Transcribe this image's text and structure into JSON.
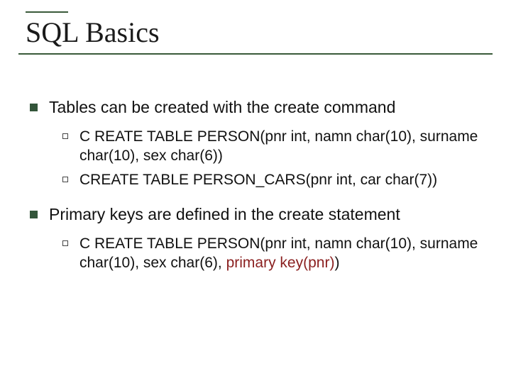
{
  "slide": {
    "title": "SQL Basics",
    "items": [
      {
        "text": "Tables can be created with the create command",
        "sub": [
          {
            "text": "C REATE TABLE PERSON(pnr int, namn char(10), surname char(10), sex char(6))"
          },
          {
            "text": "CREATE TABLE PERSON_CARS(pnr int, car char(7))"
          }
        ]
      },
      {
        "text": "Primary keys are defined in the create statement",
        "sub": [
          {
            "text_prefix": "C REATE TABLE PERSON(pnr int, namn char(10), surname char(10), sex char(6), ",
            "highlight": "primary key(pnr)",
            "text_suffix": ")"
          }
        ]
      }
    ]
  }
}
